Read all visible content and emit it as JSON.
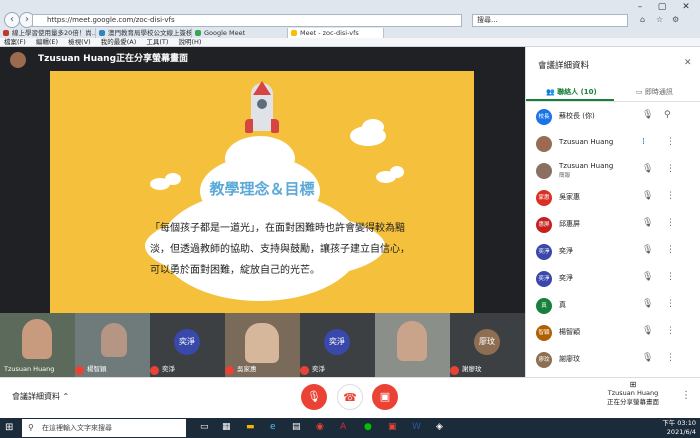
{
  "browser": {
    "address": "https://meet.google.com/zoc-disi-vfs",
    "search_placeholder": "搜尋...",
    "tabs": [
      {
        "label": "線上學習使用量多20倍！尚...",
        "color": "#c0392b"
      },
      {
        "label": "澳門教育局學校公文線上簽核...",
        "color": "#2e86c1"
      },
      {
        "label": "Google Meet",
        "color": "#34a853"
      },
      {
        "label": "Meet - zoc-disi-vfs",
        "color": "#fbbc05"
      }
    ],
    "menu": [
      "檔案(F)",
      "編輯(E)",
      "檢視(V)",
      "我的最愛(A)",
      "工具(T)",
      "說明(H)"
    ]
  },
  "meet": {
    "presenter_text": "Tzusuan Huang正在分享螢幕畫面",
    "slide": {
      "title": "教學理念＆目標",
      "body": "「每個孩子都是一道光」，在面對困難時也許會變得較為黯淡，但透過教師的協助、支持與鼓勵，讓孩子建立自信心，可以勇於面對困難，綻放自己的光芒。"
    },
    "thumbnails": [
      {
        "label": "Tzusuan Huang",
        "avatar": ""
      },
      {
        "label": "楊智穎",
        "avatar": ""
      },
      {
        "label": "奕淨",
        "avatar": "奕淨"
      },
      {
        "label": "吳家惠",
        "avatar": ""
      },
      {
        "label": "奕淨",
        "avatar": "奕淨"
      },
      {
        "label": "謝廖玟",
        "avatar": "廖玟"
      }
    ]
  },
  "bottom": {
    "meeting_details": "會議詳細資料",
    "presenter_name": "Tzusuan Huang",
    "presenter_status": "正在分享螢幕畫面"
  },
  "panel": {
    "title": "會議詳細資料",
    "tab_people": "聯絡人 (10)",
    "tab_chat": "即時通訊",
    "people": [
      {
        "name": "蘇校長 (你)",
        "avatar": "校長",
        "color": "#1a73e8",
        "sub": ""
      },
      {
        "name": "Tzusuan Huang",
        "avatar": "",
        "color": "#9b6b50",
        "sub": ""
      },
      {
        "name": "Tzusuan Huang",
        "avatar": "",
        "color": "#8d6e63",
        "sub": "簡報"
      },
      {
        "name": "吳家惠",
        "avatar": "家惠",
        "color": "#d93025",
        "sub": ""
      },
      {
        "name": "邱惠屏",
        "avatar": "惠屏",
        "color": "#c5221f",
        "sub": ""
      },
      {
        "name": "奕淨",
        "avatar": "奕淨",
        "color": "#3949ab",
        "sub": ""
      },
      {
        "name": "奕淨",
        "avatar": "奕淨",
        "color": "#3949ab",
        "sub": ""
      },
      {
        "name": "真",
        "avatar": "真",
        "color": "#188038",
        "sub": ""
      },
      {
        "name": "楊智穎",
        "avatar": "智穎",
        "color": "#b06000",
        "sub": ""
      },
      {
        "name": "謝廖玟",
        "avatar": "廖玟",
        "color": "#8e6e53",
        "sub": ""
      }
    ]
  },
  "taskbar": {
    "search_placeholder": "在這裡輸入文字來搜尋",
    "time": "下午 03:10",
    "date": "2021/6/4"
  }
}
